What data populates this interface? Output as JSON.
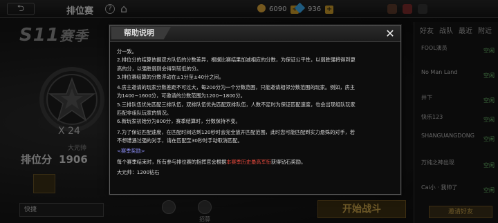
{
  "topbar": {
    "back_label": "⮌",
    "title": "排位赛",
    "help_label": "?",
    "home_icon": "home-icon",
    "coins": "6090",
    "gems": "936",
    "plus": "+"
  },
  "season": {
    "label": "S11",
    "suffix": "赛季",
    "rank_x": "X 24",
    "rank_title": "大元帅",
    "score_label": "排位分",
    "score_value": "1906"
  },
  "bottom": {
    "quick_label": "快捷",
    "start_label": "开始战斗",
    "invite_label": "邀请好友",
    "hint_label": "招募"
  },
  "friends": {
    "tabs": [
      "好友",
      "战队",
      "最近",
      "附近"
    ],
    "items": [
      {
        "name": "FOOL演员",
        "status": "空闲"
      },
      {
        "name": "No Man Land",
        "status": "空闲"
      },
      {
        "name": "井下",
        "status": "空闲"
      },
      {
        "name": "快乐123",
        "status": "空闲"
      },
      {
        "name": "SHANGUANGDONG",
        "status": "空闲"
      },
      {
        "name": "万纯之神出现",
        "status": "空闲"
      },
      {
        "name": "Cai小 · 我帅了",
        "status": "空闲"
      }
    ]
  },
  "modal": {
    "title": "帮助说明",
    "close_label": "✕",
    "lines": [
      "分一致。",
      "2.排位分的结算依据双方队伍的分数差异，根据比赛结果加减相应的分数，为保证公平性，以弱胜强将得到更",
      "高的分，以强胜弱则会得到较低的分。",
      "3.排位赛结算的分数浮动在±1分至±40分之间。",
      "4.房主邀请的玩家分数差距不可过大，每200分为一个分数范围，只能邀请相邻分数范围的玩家。例如，房主",
      "为1400~1600分，可邀请的分数范围为1200~1800分。",
      "5.三排队伍优先匹配三排队伍，双排队伍优先匹配双排队伍，人数不足时为保证匹配速度，也会出现组队玩家",
      "匹配非组队玩家的情况。",
      "6.新玩家初始分为800分，赛季结算时，分数保持不变。",
      "7.为了保证匹配速度，在匹配时间达到120秒时会完全放开匹配范围，此时您可能匹配到实力悬殊的对手，若",
      "不想遭遇过强的对手，请在匹配至30秒时手动取消匹配。"
    ],
    "reward_section": "<赛季奖励>",
    "reward_text_before": "每个赛季结束时，所有参与排位赛的指挥官会根据",
    "reward_highlight": "本赛季历史最高军衔",
    "reward_text_after": "获得钻石奖励。",
    "reward_item": "大元帅：1200钻石"
  }
}
